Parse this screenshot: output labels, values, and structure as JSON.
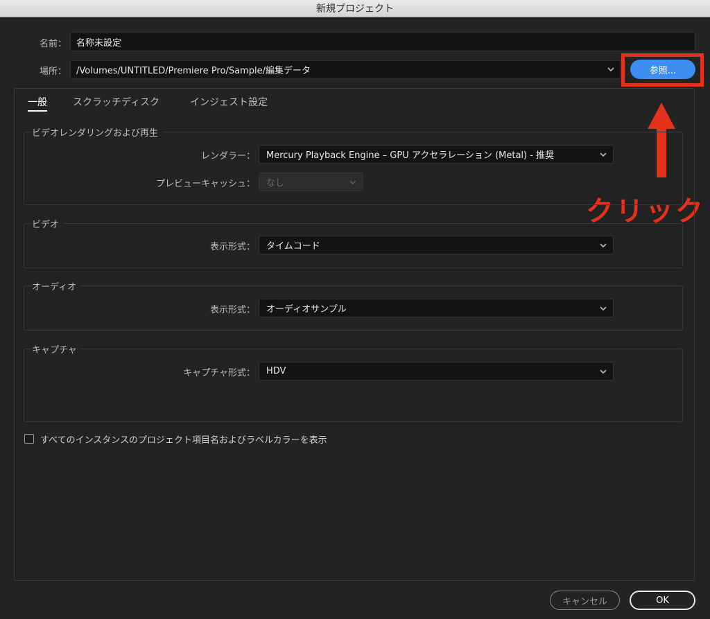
{
  "window": {
    "title": "新規プロジェクト"
  },
  "project": {
    "name_label": "名前：",
    "name_value": "名称未設定",
    "location_label": "場所：",
    "location_value": "/Volumes/UNTITLED/Premiere Pro/Sample/編集データ",
    "browse_label": "参照..."
  },
  "tabs": [
    {
      "label": "一般",
      "active": true
    },
    {
      "label": "スクラッチディスク",
      "active": false
    },
    {
      "label": "インジェスト設定",
      "active": false
    }
  ],
  "sections": {
    "render": {
      "title": "ビデオレンダリングおよび再生",
      "renderer_label": "レンダラー：",
      "renderer_value": "Mercury Playback Engine – GPU アクセラレーション (Metal) - 推奨",
      "preview_cache_label": "プレビューキャッシュ：",
      "preview_cache_value": "なし"
    },
    "video": {
      "title": "ビデオ",
      "display_format_label": "表示形式：",
      "display_format_value": "タイムコード"
    },
    "audio": {
      "title": "オーディオ",
      "display_format_label": "表示形式：",
      "display_format_value": "オーディオサンプル"
    },
    "capture": {
      "title": "キャプチャ",
      "format_label": "キャプチャ形式：",
      "format_value": "HDV"
    }
  },
  "option": {
    "show_labels_label": "すべてのインスタンスのプロジェクト項目名およびラベルカラーを表示",
    "checked": false
  },
  "footer": {
    "cancel_label": "キャンセル",
    "ok_label": "OK"
  },
  "annotation": {
    "text": "クリック",
    "color": "#e2321c"
  },
  "colors": {
    "accent": "#3c8ef0",
    "annotation": "#e2321c",
    "background": "#232323"
  }
}
